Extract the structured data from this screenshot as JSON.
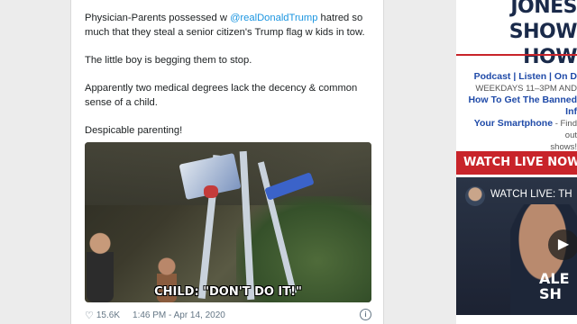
{
  "tweet": {
    "text_prefix": "Physician-Parents possessed w ",
    "mention": "@realDonaldTrump",
    "text_suffix": " hatred so much that they steal a senior citizen's Trump flag w kids in tow.",
    "para2": "The little boy is begging them to stop.",
    "para3": "Apparently two medical degrees lack the decency & common sense of a child.",
    "para4": "Despicable parenting!",
    "video_caption": "CHILD: \"DON'T DO IT!\"",
    "likes": "15.6K",
    "timestamp": "1:46 PM - Apr 14, 2020",
    "info_icon_glyph": "i",
    "mention_color": "#1b95e0"
  },
  "sidebar": {
    "banner_line1": "JONES SHOW",
    "banner_line2": "HOW",
    "link_podcast": "Podcast",
    "sep1": " | ",
    "link_listen": "Listen",
    "sep2": " | ",
    "link_on": "On D",
    "days": "WEEKDAYS 11–3PM AND",
    "banned_line1": "How To Get The Banned Inf",
    "banned_line2": "Your Smartphone",
    "banned_tail": " - Find out",
    "shows": "shows!",
    "watch_live": "WATCH LIVE NOW",
    "video_title": "WATCH LIVE: TH",
    "overlay_l1": "ALE",
    "overlay_l2": "SH",
    "accent_red": "#c8242a",
    "link_blue": "#1f4aa8"
  }
}
